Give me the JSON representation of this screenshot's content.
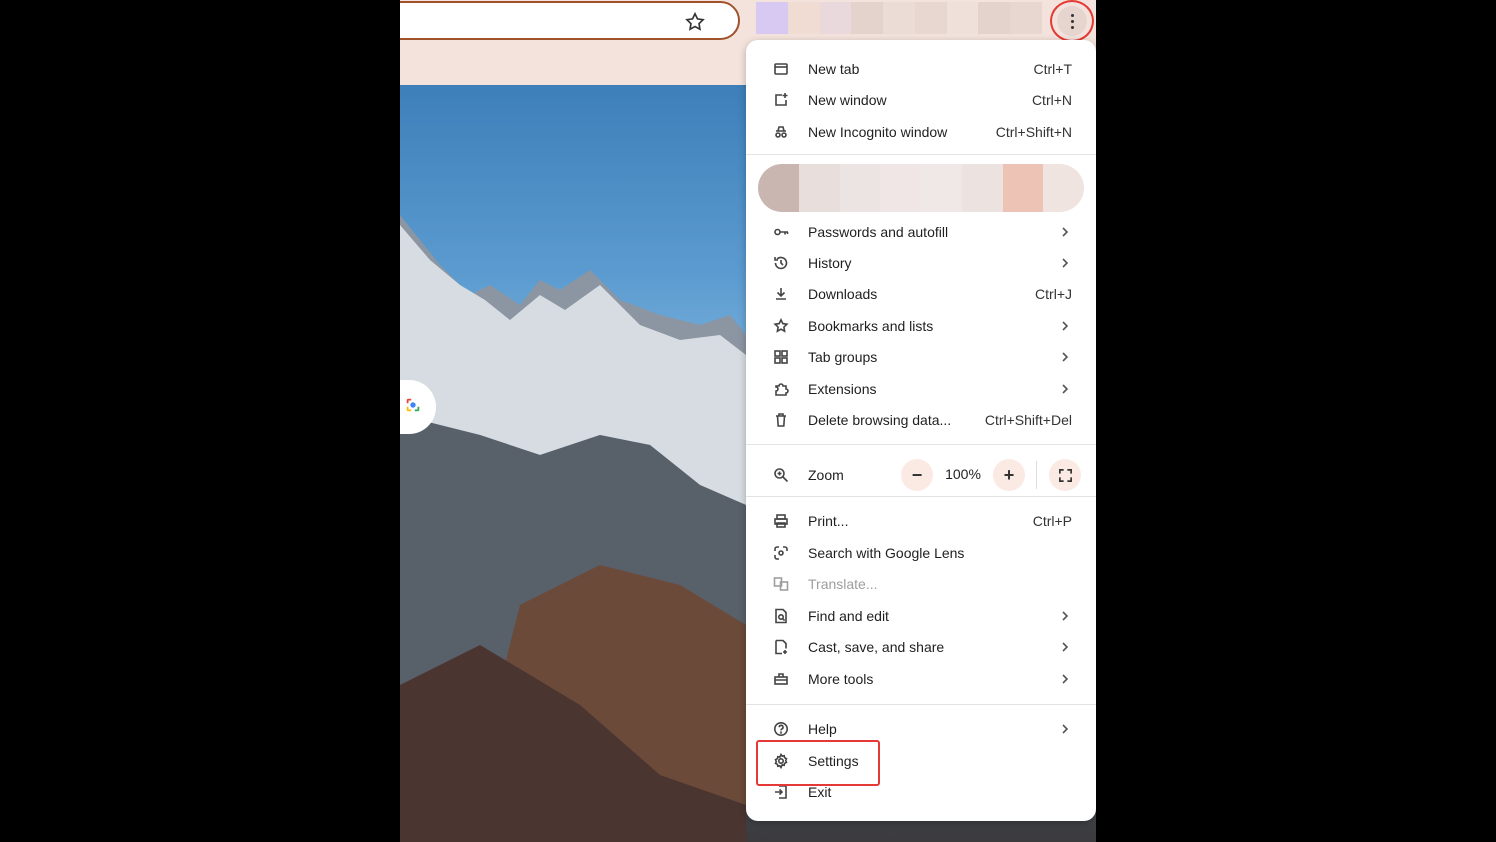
{
  "colors": {
    "accent": "#e53935",
    "menu_bg": "#ffffff",
    "toolbar_bg": "#f4e3dc"
  },
  "menu": {
    "new_tab": {
      "label": "New tab",
      "shortcut": "Ctrl+T"
    },
    "new_window": {
      "label": "New window",
      "shortcut": "Ctrl+N"
    },
    "new_incognito": {
      "label": "New Incognito window",
      "shortcut": "Ctrl+Shift+N"
    },
    "passwords": {
      "label": "Passwords and autofill"
    },
    "history": {
      "label": "History"
    },
    "downloads": {
      "label": "Downloads",
      "shortcut": "Ctrl+J"
    },
    "bookmarks": {
      "label": "Bookmarks and lists"
    },
    "tab_groups": {
      "label": "Tab groups"
    },
    "extensions": {
      "label": "Extensions"
    },
    "delete_data": {
      "label": "Delete browsing data...",
      "shortcut": "Ctrl+Shift+Del"
    },
    "zoom": {
      "label": "Zoom",
      "value": "100%",
      "minus": "−",
      "plus": "+"
    },
    "print": {
      "label": "Print...",
      "shortcut": "Ctrl+P"
    },
    "lens": {
      "label": "Search with Google Lens"
    },
    "translate": {
      "label": "Translate..."
    },
    "find_edit": {
      "label": "Find and edit"
    },
    "cast": {
      "label": "Cast, save, and share"
    },
    "more_tools": {
      "label": "More tools"
    },
    "help": {
      "label": "Help"
    },
    "settings": {
      "label": "Settings"
    },
    "exit": {
      "label": "Exit"
    }
  }
}
